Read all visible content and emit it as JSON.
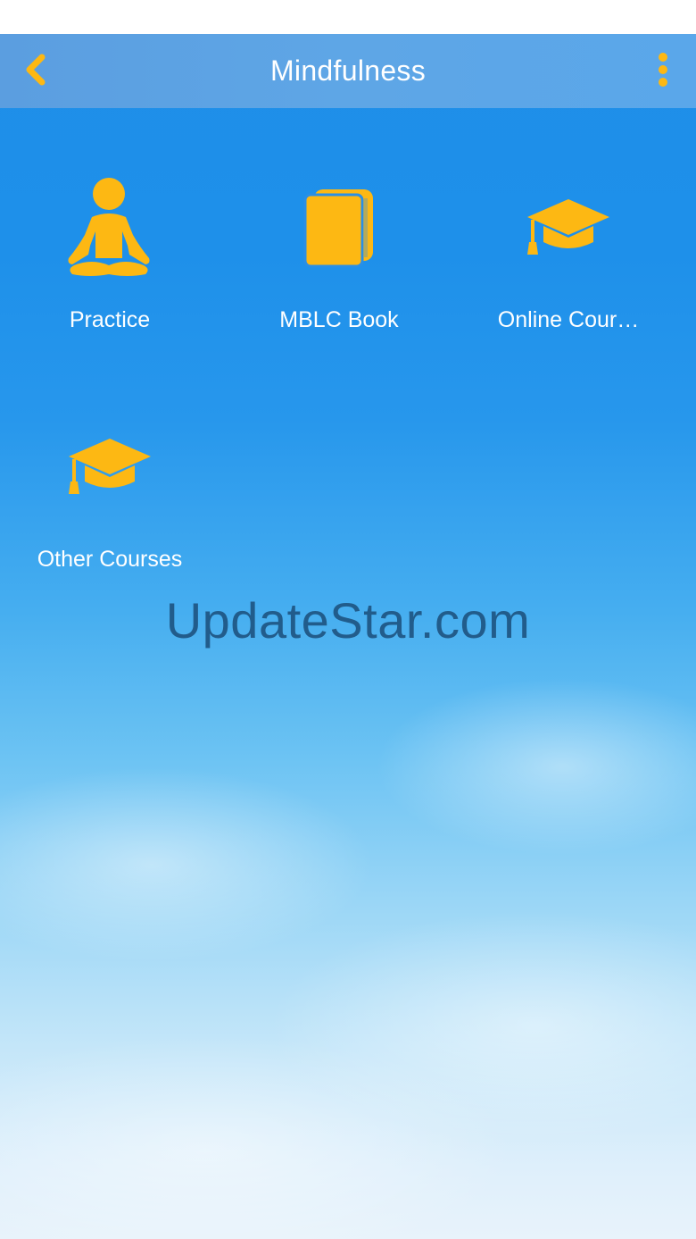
{
  "header": {
    "title": "Mindfulness",
    "back_icon": "chevron-left-icon",
    "menu_icon": "more-vertical-icon"
  },
  "tiles": [
    {
      "label": "Practice",
      "icon": "meditation-icon"
    },
    {
      "label": "MBLC Book",
      "icon": "book-icon"
    },
    {
      "label": "Online Cour…",
      "icon": "graduation-cap-icon"
    },
    {
      "label": "Other Courses",
      "icon": "graduation-cap-icon"
    }
  ],
  "watermark": "UpdateStar.com",
  "colors": {
    "accent": "#FDB813",
    "header_bg": "#5EA6E6",
    "sky_top": "#1F8EE8",
    "sky_bottom": "#E8F3FB"
  }
}
